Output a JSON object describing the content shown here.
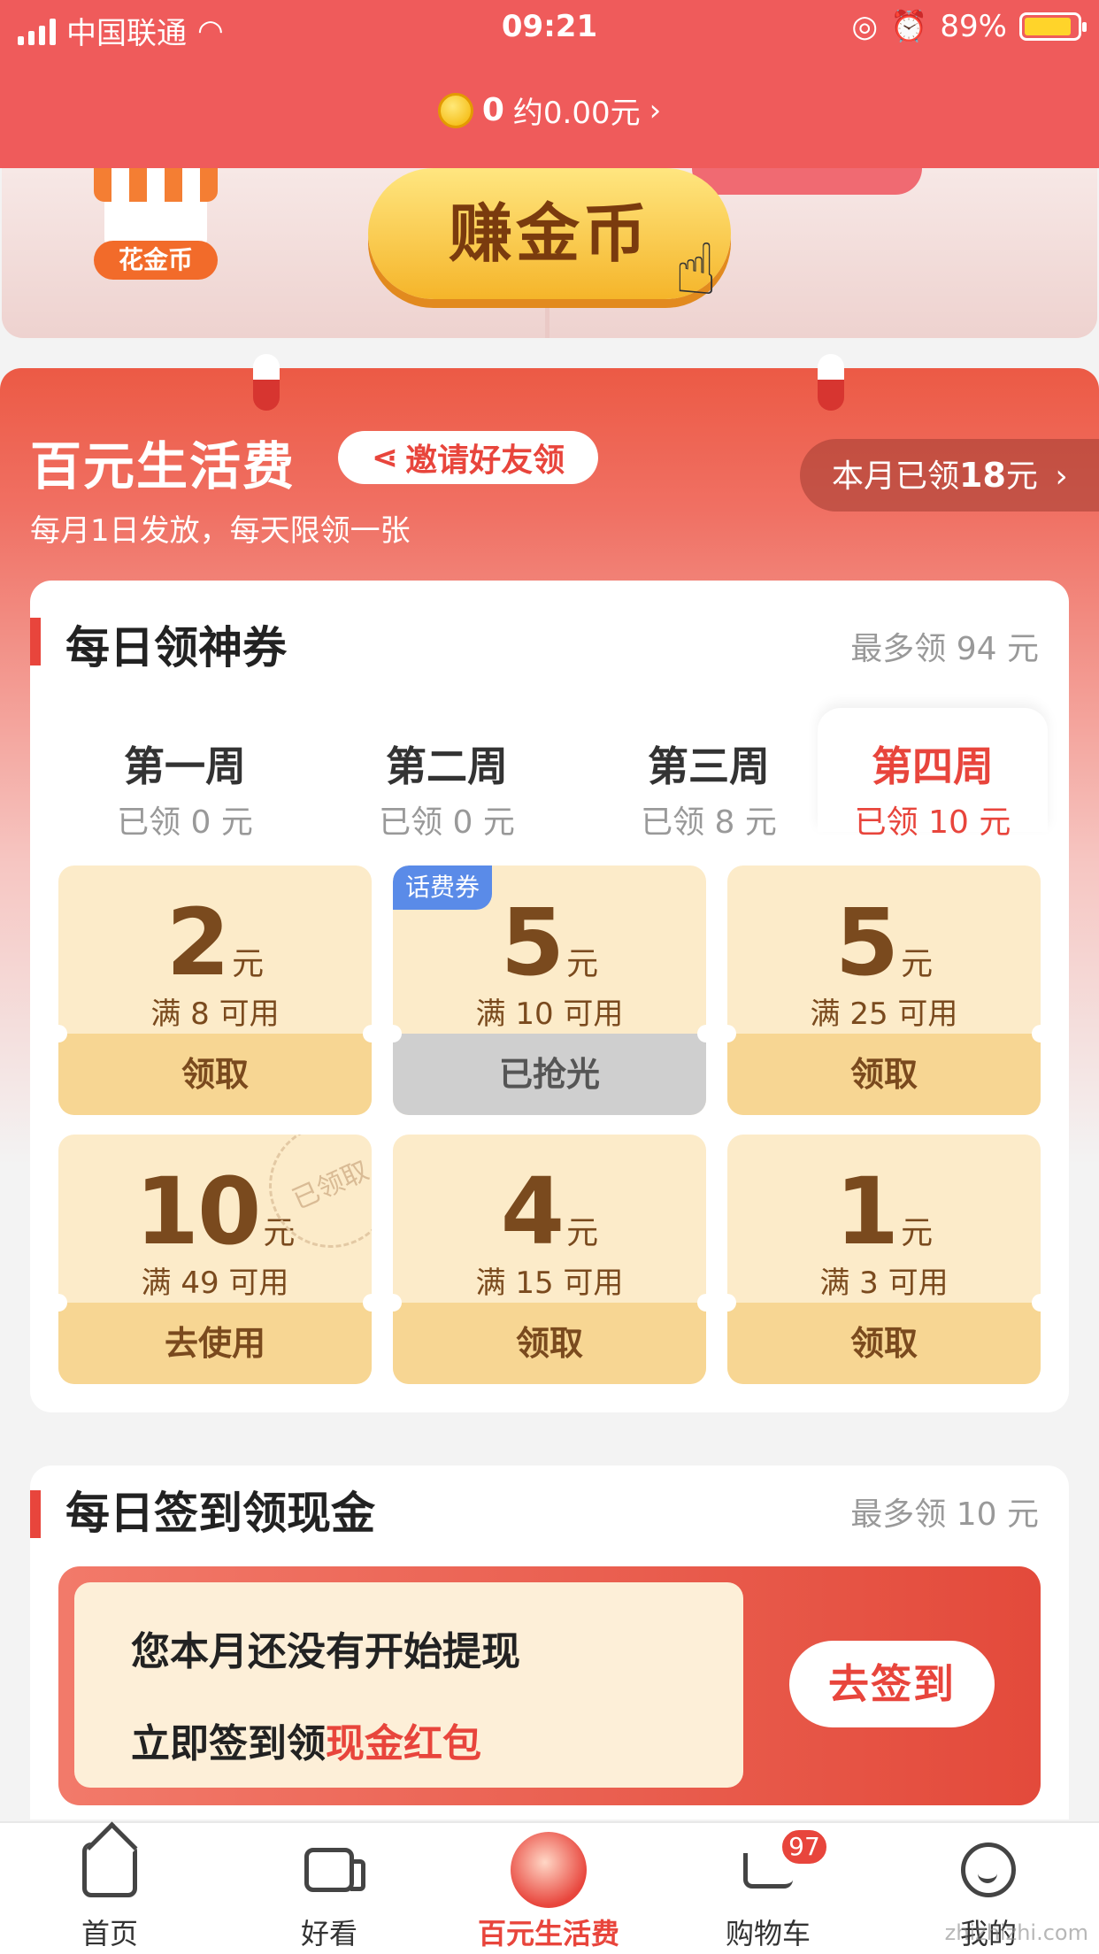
{
  "status_bar": {
    "carrier": "中国联通",
    "time": "09:21",
    "battery": "89%"
  },
  "coin_bar": {
    "coins": "0",
    "approx": "约0.00元",
    "arrow": "›"
  },
  "banner": {
    "flower_coin": "花金币",
    "earn_coin": "赚金币"
  },
  "life_section": {
    "title": "百元生活费",
    "invite_label": "邀请好友领",
    "subtitle": "每月1日发放，每天限领一张",
    "month_prefix": "本月已领",
    "month_amount": "18",
    "month_unit": "元",
    "month_arrow": "›"
  },
  "daily_coupon": {
    "title": "每日领神券",
    "max": "最多领 94 元",
    "weeks": [
      {
        "name": "第一周",
        "got": "已领 0 元"
      },
      {
        "name": "第二周",
        "got": "已领 0 元"
      },
      {
        "name": "第三周",
        "got": "已领 8 元"
      },
      {
        "name": "第四周",
        "got": "已领 10 元"
      }
    ],
    "active_week": 3,
    "coupons": [
      {
        "amount": "2",
        "unit": "元",
        "cond": "满 8 可用",
        "action": "领取",
        "tag": "",
        "stamp": ""
      },
      {
        "amount": "5",
        "unit": "元",
        "cond": "满 10 可用",
        "action": "已抢光",
        "tag": "话费券",
        "stamp": ""
      },
      {
        "amount": "5",
        "unit": "元",
        "cond": "满 25 可用",
        "action": "领取",
        "tag": "",
        "stamp": ""
      },
      {
        "amount": "10",
        "unit": "元",
        "cond": "满 49 可用",
        "action": "去使用",
        "tag": "",
        "stamp": "已领取"
      },
      {
        "amount": "4",
        "unit": "元",
        "cond": "满 15 可用",
        "action": "领取",
        "tag": "",
        "stamp": ""
      },
      {
        "amount": "1",
        "unit": "元",
        "cond": "满 3 可用",
        "action": "领取",
        "tag": "",
        "stamp": ""
      }
    ]
  },
  "signin": {
    "title": "每日签到领现金",
    "max": "最多领 10 元",
    "line1": "您本月还没有开始提现",
    "line2_prefix": "立即签到领",
    "line2_highlight": "现金红包",
    "button": "去签到"
  },
  "tabbar": {
    "items": [
      {
        "label": "首页",
        "icon": "home-icon"
      },
      {
        "label": "好看",
        "icon": "video-icon"
      },
      {
        "label": "百元生活费",
        "icon": "life-fee-icon"
      },
      {
        "label": "购物车",
        "icon": "cart-icon"
      },
      {
        "label": "我的",
        "icon": "profile-icon"
      }
    ],
    "active": 2,
    "cart_badge": "97"
  },
  "watermark": "zhizhizhi.com",
  "colors": {
    "accent": "#e8453c",
    "topbar": "#ef5b5b",
    "coupon_bg": "#fcebc9",
    "coupon_btn": "#f7d693"
  }
}
